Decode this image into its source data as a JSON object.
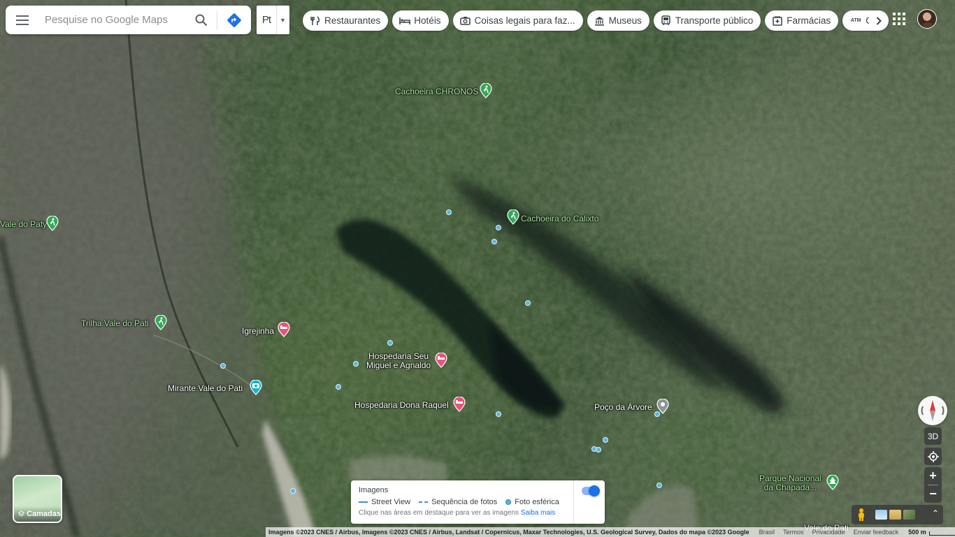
{
  "search": {
    "placeholder": "Pesquise no Google Maps"
  },
  "language": {
    "code": "Pt"
  },
  "chips": [
    {
      "label": "Restaurantes",
      "icon": "fork-knife-icon"
    },
    {
      "label": "Hotéis",
      "icon": "bed-icon"
    },
    {
      "label": "Coisas legais para faz...",
      "icon": "camera-icon"
    },
    {
      "label": "Museus",
      "icon": "museum-icon"
    },
    {
      "label": "Transporte público",
      "icon": "bus-icon"
    },
    {
      "label": "Farmácias",
      "icon": "pharmacy-icon"
    },
    {
      "label": "C",
      "icon": "atm-icon",
      "prefix": "ATM"
    }
  ],
  "places": {
    "cachoeira_chronos": "Cachoeira CHRONOS",
    "cachoeira_calixto": "Cachoeira do Calixto",
    "vale_paty": "Vale do Paty",
    "trilha_vale_pati": "Trilha Vale do Pati",
    "igrejinha": "Igrejinha",
    "mirante": "Mirante Vale do Pati",
    "hospedaria_seu_miguel_1": "Hospedaria Seu",
    "hospedaria_seu_miguel_2": "Miguel e Agnaldo",
    "hospedaria_dona_raquel": "Hospedaria Dona Raquel",
    "poco_arvore": "Poço da Árvore",
    "parque_nacional_1": "Parque Nacional",
    "parque_nacional_2": "da Chapada...",
    "vale_pati_bottom": "Vale do Pati"
  },
  "layers": {
    "label": "Camadas"
  },
  "imagery_panel": {
    "title": "Imagens",
    "legend": [
      "Street View",
      "Sequência de fotos",
      "Foto esférica"
    ],
    "hint": "Clique nas áreas em destaque para ver as imagens",
    "link": "Saiba mais",
    "toggle_on": true
  },
  "controls": {
    "three_d": "3D"
  },
  "footer": {
    "attribution": "Imagens ©2023 CNES / Airbus, Imagens ©2023 CNES / Airbus, Landsat / Copernicus, Maxar Technologies, U.S. Geological Survey, Dados do mapa ©2023 Google",
    "country": "Brasil",
    "terms": "Termos",
    "privacy": "Privacidade",
    "feedback": "Enviar feedback",
    "scale": "500 m"
  },
  "colors": {
    "hotel_pin": "#e8547a",
    "hike_pin": "#34a853",
    "photo_pin": "#12b5cb",
    "dot": "#5bb3de"
  }
}
